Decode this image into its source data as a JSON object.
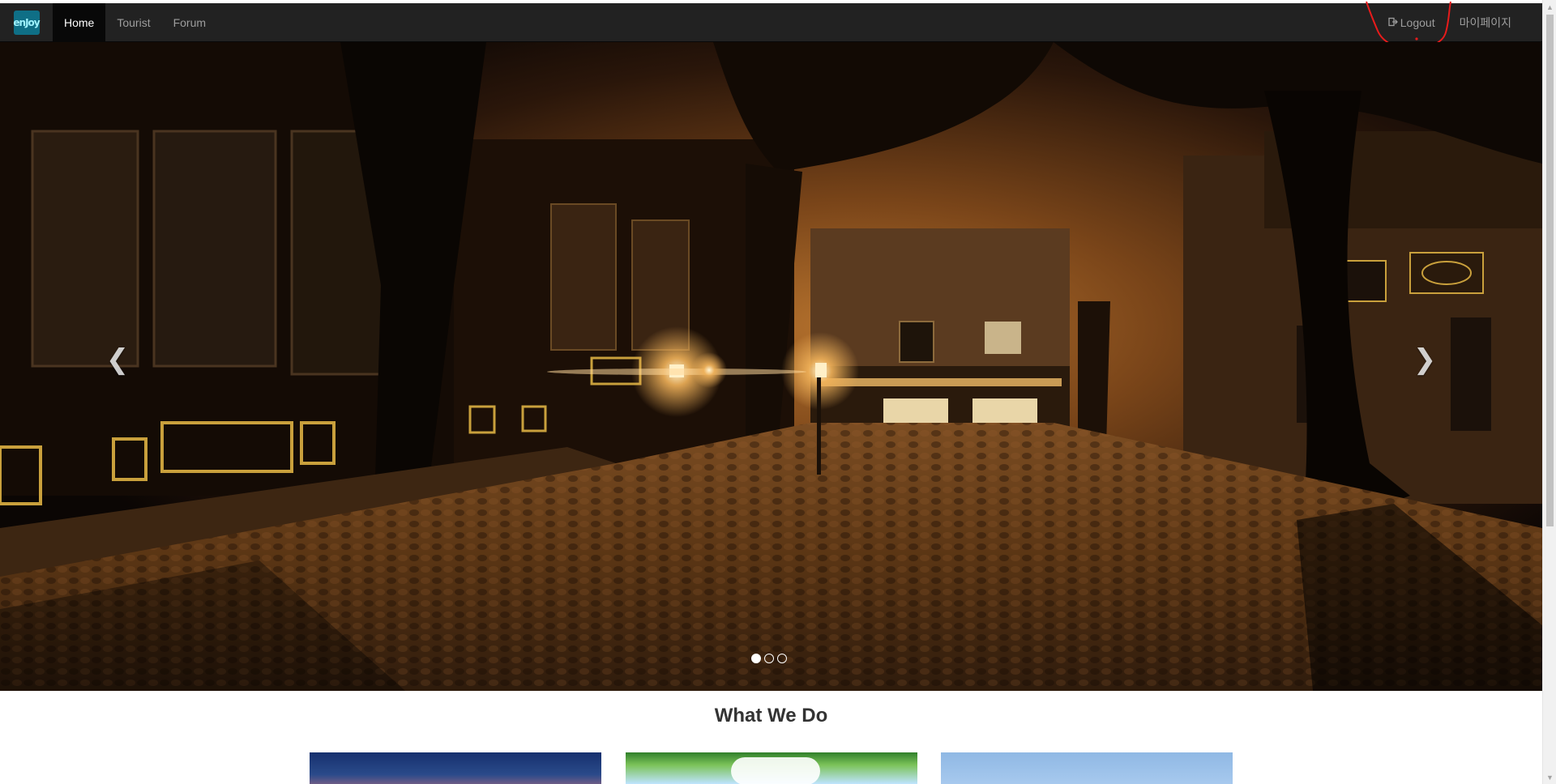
{
  "navbar": {
    "brand_text": "enJoy",
    "items": [
      {
        "label": "Home",
        "active": true
      },
      {
        "label": "Tourist",
        "active": false
      },
      {
        "label": "Forum",
        "active": false
      }
    ],
    "right_items": [
      {
        "label": "Logout",
        "icon": "logout-icon"
      },
      {
        "label": "마이페이지"
      }
    ]
  },
  "carousel": {
    "prev_icon": "chevron-left-icon",
    "next_icon": "chevron-right-icon",
    "slide_count": 3,
    "active_slide": 1
  },
  "section": {
    "title": "What We Do"
  },
  "colors": {
    "navbar_bg": "#222222",
    "nav_text": "#9d9d9d",
    "annotation": "#e81b1b"
  }
}
